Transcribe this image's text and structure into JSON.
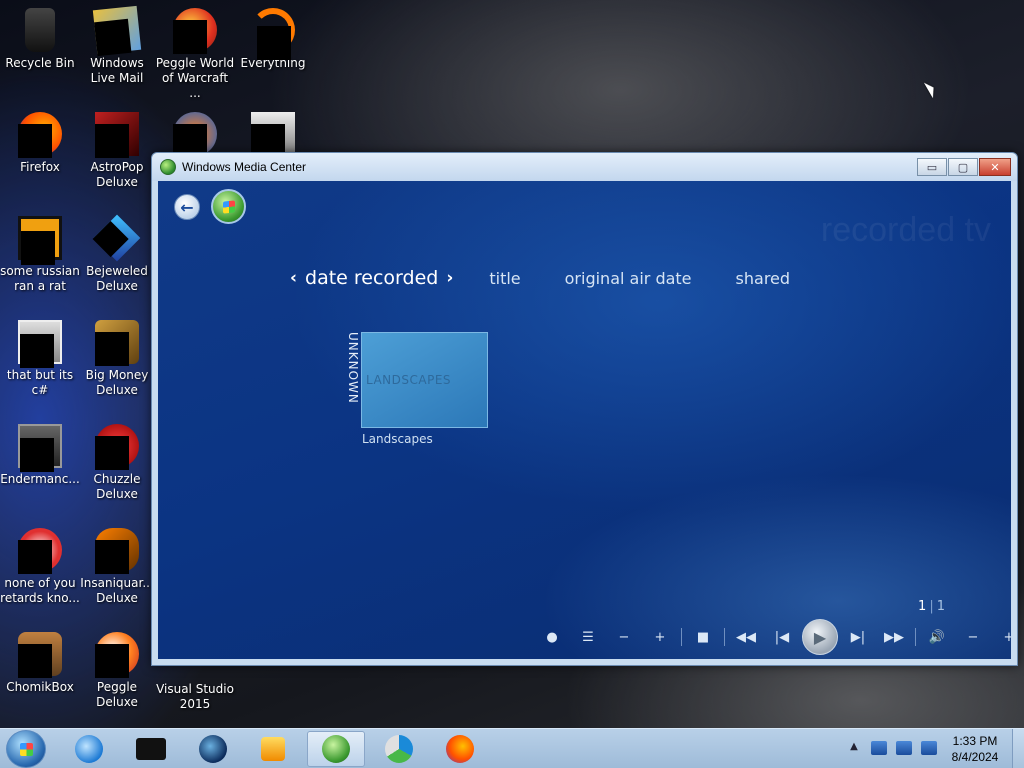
{
  "desktop": {
    "icons": [
      {
        "label": "Recycle Bin"
      },
      {
        "label": "Windows Live Mail"
      },
      {
        "label": "Peggle World of Warcraft ..."
      },
      {
        "label": "Everything"
      },
      {
        "label": "Firefox"
      },
      {
        "label": "AstroPop Deluxe"
      },
      {
        "label": "some russian ran a rat"
      },
      {
        "label": "Bejeweled Deluxe"
      },
      {
        "label": "that but its c#"
      },
      {
        "label": "Big Money Deluxe"
      },
      {
        "label": "Endermanc..."
      },
      {
        "label": "Chuzzle Deluxe"
      },
      {
        "label": "none of you retards kno..."
      },
      {
        "label": "Insaniquar... Deluxe"
      },
      {
        "label": "ChomikBox"
      },
      {
        "label": "Peggle Deluxe"
      },
      {
        "label": "Visual Studio 2015"
      }
    ]
  },
  "window": {
    "title": "Windows Media Center",
    "controls": {
      "minimize": "▭",
      "maximize": "▢",
      "close": "✕"
    }
  },
  "media_center": {
    "watermark": "recorded tv",
    "sort_options": {
      "active": "date recorded",
      "others": [
        "title",
        "original air date",
        "shared"
      ]
    },
    "group": {
      "vertical_label": "UNKNOWN",
      "tile_text": "LANDSCAPES",
      "caption": "Landscapes"
    },
    "pager": {
      "current": "1",
      "total": "1"
    },
    "transport_icons": [
      "record-icon",
      "guide-icon",
      "channel-down-icon",
      "channel-up-icon",
      "stop-icon",
      "rewind-icon",
      "skip-back-icon",
      "play-icon",
      "skip-forward-icon",
      "fast-forward-icon",
      "mute-icon",
      "volume-down-icon",
      "volume-up-icon"
    ]
  },
  "taskbar": {
    "clock": {
      "time": "1:33 PM",
      "date": "8/4/2024"
    },
    "tray_expand": "▲"
  }
}
